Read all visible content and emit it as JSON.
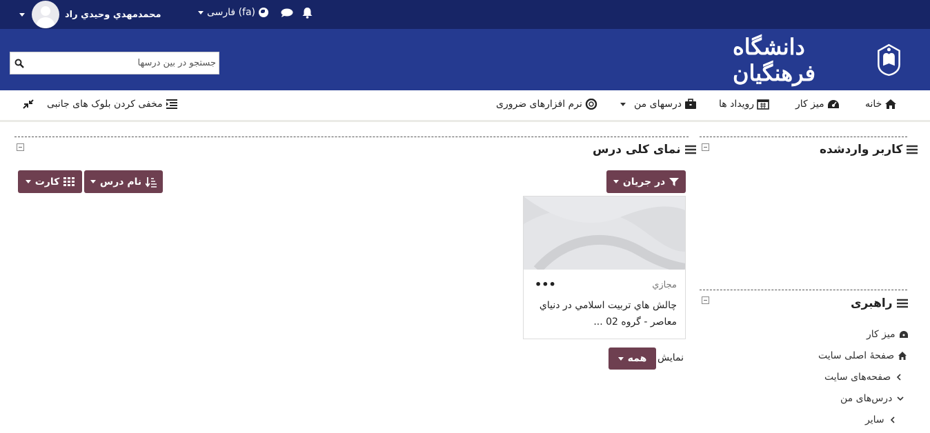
{
  "topbar": {
    "user_name": "محمدمهدي وحيدي راد",
    "language": "فارسی (fa)",
    "icons": [
      "caret-down-icon",
      "avatar",
      "globe-icon",
      "chat-icon",
      "bell-icon"
    ]
  },
  "header": {
    "search_placeholder": "جستجو در بین درسها",
    "logo_text": "دانشگاه فرهنگیان"
  },
  "nav": {
    "home": "خانه",
    "dashboard": "میز کار",
    "events": "رویداد ها",
    "my_courses": "درسهای من",
    "software": "نرم افزارهای ضروری",
    "hide_blocks": "مخفی کردن بلوک های جانبی"
  },
  "logged_in_block": {
    "title": "کاربر واردشده"
  },
  "course_overview": {
    "title": "نمای کلی درس",
    "filter_label": "در جريان",
    "sort_label": "نام درس",
    "view_label": "كارت",
    "card": {
      "category": "مجازي",
      "title": "چالش هاي تربيت اسلامي در دنياي معاصر - گروه 02 ..."
    },
    "show_label": "نمایش",
    "show_value": "همه"
  },
  "guide_block": {
    "title": "راهبری",
    "items": [
      {
        "label": "میز کار",
        "icon": "dashboard-icon"
      },
      {
        "label": "صفحهٔ اصلی سایت",
        "icon": "home-icon"
      },
      {
        "label": "صفحه‌های سایت",
        "icon": "chevron-left-icon"
      },
      {
        "label": "درس‌های من",
        "icon": "chevron-down-icon"
      },
      {
        "label": "سایر",
        "icon": "chevron-left-icon"
      }
    ]
  },
  "colors": {
    "topbar": "#172566",
    "header": "#253a90",
    "button": "#6e3f50"
  }
}
